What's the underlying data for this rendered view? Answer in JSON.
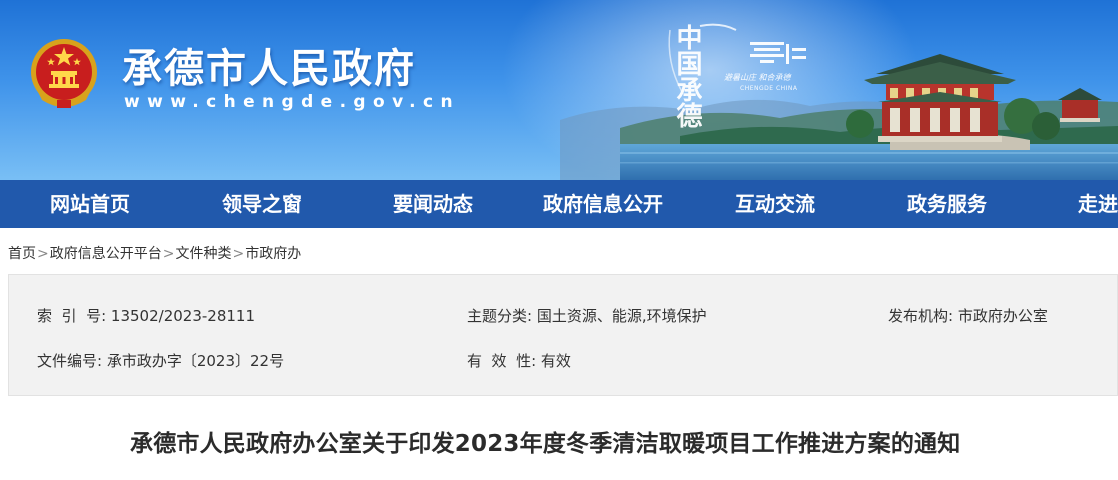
{
  "header": {
    "site_title": "承德市人民政府",
    "site_url": "www.chengde.gov.cn",
    "emblem_icon": "national-emblem-icon",
    "brand": {
      "logo_zh": "中国承德",
      "slogan": "避暑山庄  和合承德",
      "logo_en": "CHENGDE CHINA"
    },
    "colors": {
      "banner_top": "#1f72d6",
      "banner_bottom": "#79bff5",
      "nav_bg": "#2159ac"
    }
  },
  "nav": {
    "items": [
      {
        "label": "网站首页"
      },
      {
        "label": "领导之窗"
      },
      {
        "label": "要闻动态"
      },
      {
        "label": "政府信息公开"
      },
      {
        "label": "互动交流"
      },
      {
        "label": "政务服务"
      },
      {
        "label": "走进"
      }
    ]
  },
  "breadcrumb": {
    "items": [
      "首页",
      "政府信息公开平台",
      "文件种类",
      "市政府办"
    ],
    "separator": ">"
  },
  "meta": {
    "index_no": {
      "label": "索  引  号:",
      "value": "13502/2023-28111"
    },
    "topic": {
      "label": "主题分类:",
      "value": "国土资源、能源,环境保护"
    },
    "publisher": {
      "label": "发布机构:",
      "value": "市政府办公室"
    },
    "doc_no": {
      "label": "文件编号:",
      "value": "承市政办字〔2023〕22号"
    },
    "validity": {
      "label": "有  效  性:",
      "value": "有效"
    }
  },
  "document": {
    "title": "承德市人民政府办公室关于印发2023年度冬季清洁取暖项目工作推进方案的通知"
  }
}
